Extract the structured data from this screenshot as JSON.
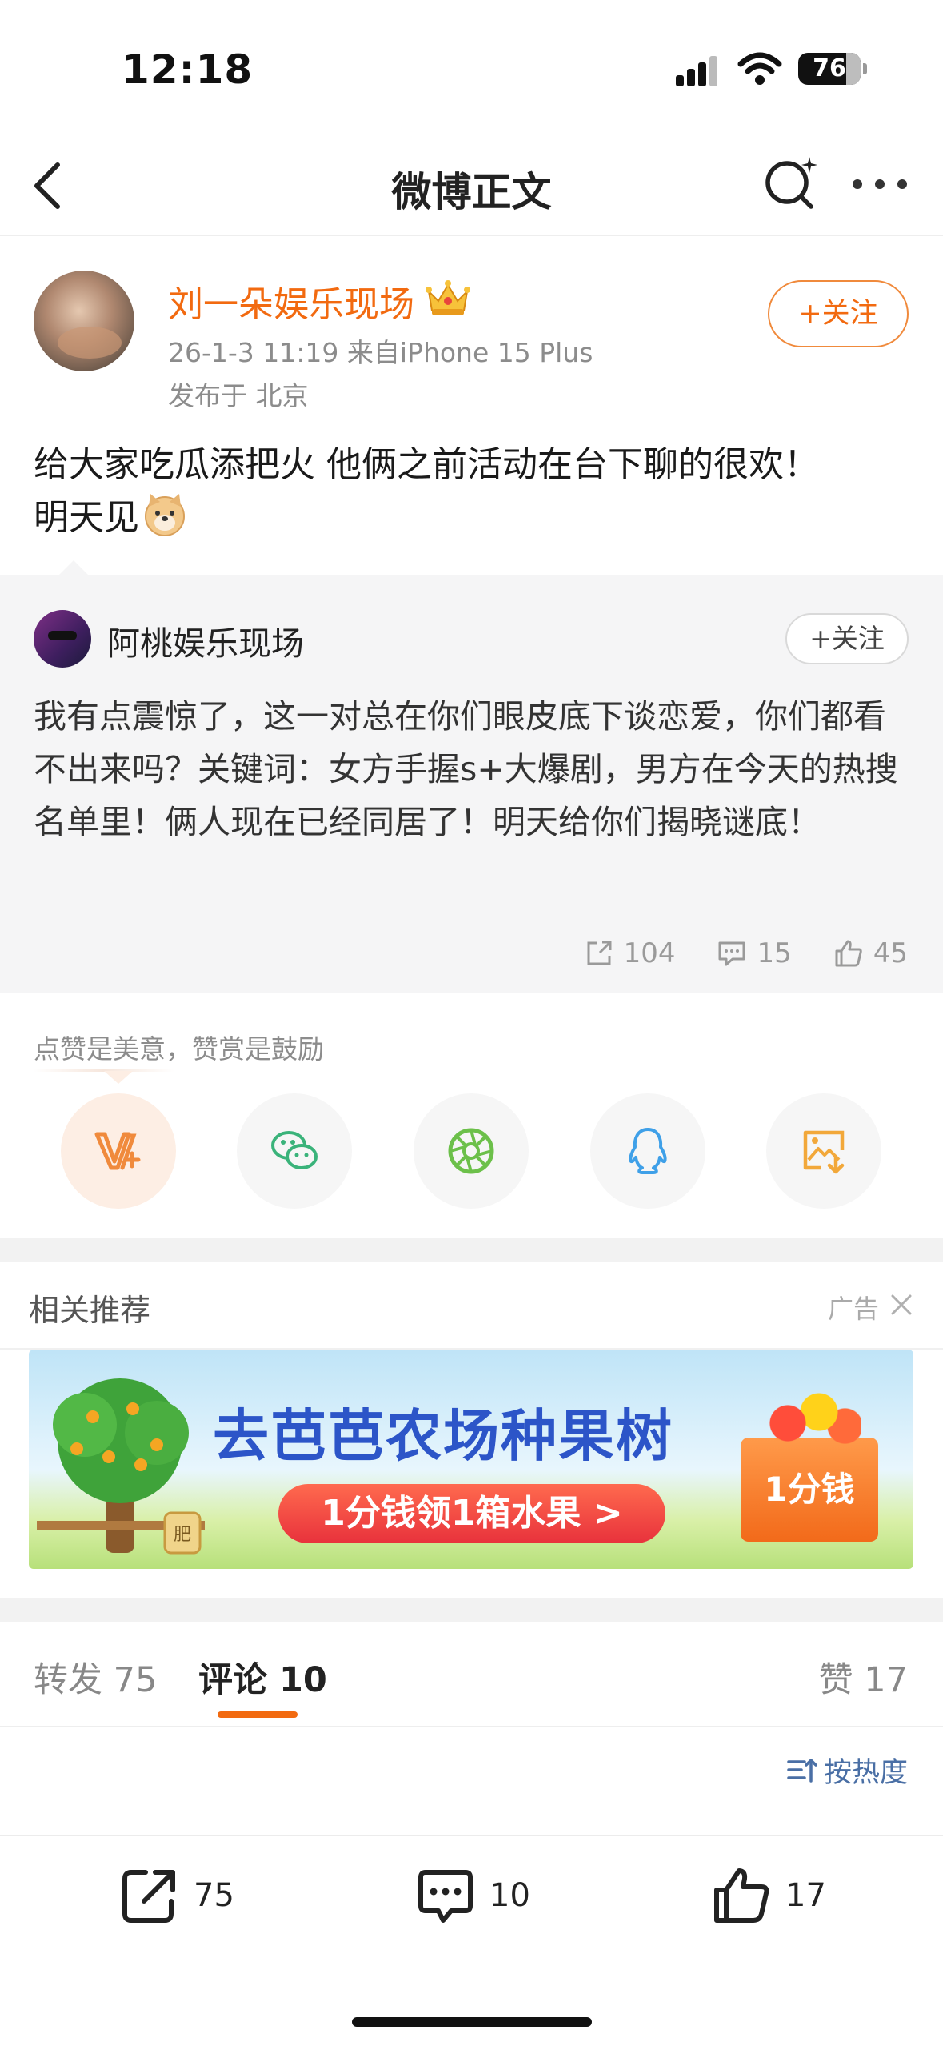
{
  "status_bar": {
    "time": "12:18",
    "battery": "76"
  },
  "nav": {
    "title": "微博正文"
  },
  "post": {
    "author": "刘一朵娱乐现场",
    "meta": "26-1-3 11:19  来自iPhone 15 Plus",
    "location": "发布于 北京",
    "follow_label": "+关注",
    "text_line1": "给大家吃瓜添把火 他俩之前活动在台下聊的很欢！",
    "text_line2": "明天见"
  },
  "repost": {
    "author": "阿桃娱乐现场",
    "follow_label": "+关注",
    "text": "我有点震惊了，这一对总在你们眼皮底下谈恋爱，你们都看不出来吗？关键词：女方手握s+大爆剧，男方在今天的热搜名单里！俩人现在已经同居了！明天给你们揭晓谜底！",
    "shares": "104",
    "comments": "15",
    "likes": "45"
  },
  "reward": {
    "label": "点赞是美意，赞赏是鼓励"
  },
  "share_targets": [
    "reward-icon",
    "wechat-icon",
    "moments-icon",
    "qq-icon",
    "save-image-icon"
  ],
  "recommend": {
    "label": "相关推荐",
    "ad_label": "广告",
    "banner_title": "去芭芭农场种果树",
    "banner_button": "1分钱领1箱水果 >",
    "banner_badge": "1分钱",
    "banner_tree_label": "肥"
  },
  "tabs": {
    "repost": "转发 75",
    "comment": "评论 10",
    "like": "赞 17"
  },
  "sort": {
    "label": "按热度"
  },
  "bottom_bar": {
    "repost": "75",
    "comment": "10",
    "like": "17"
  },
  "colors": {
    "accent": "#f26a10",
    "link": "#4a6fa5",
    "muted": "#8c8c8c"
  }
}
